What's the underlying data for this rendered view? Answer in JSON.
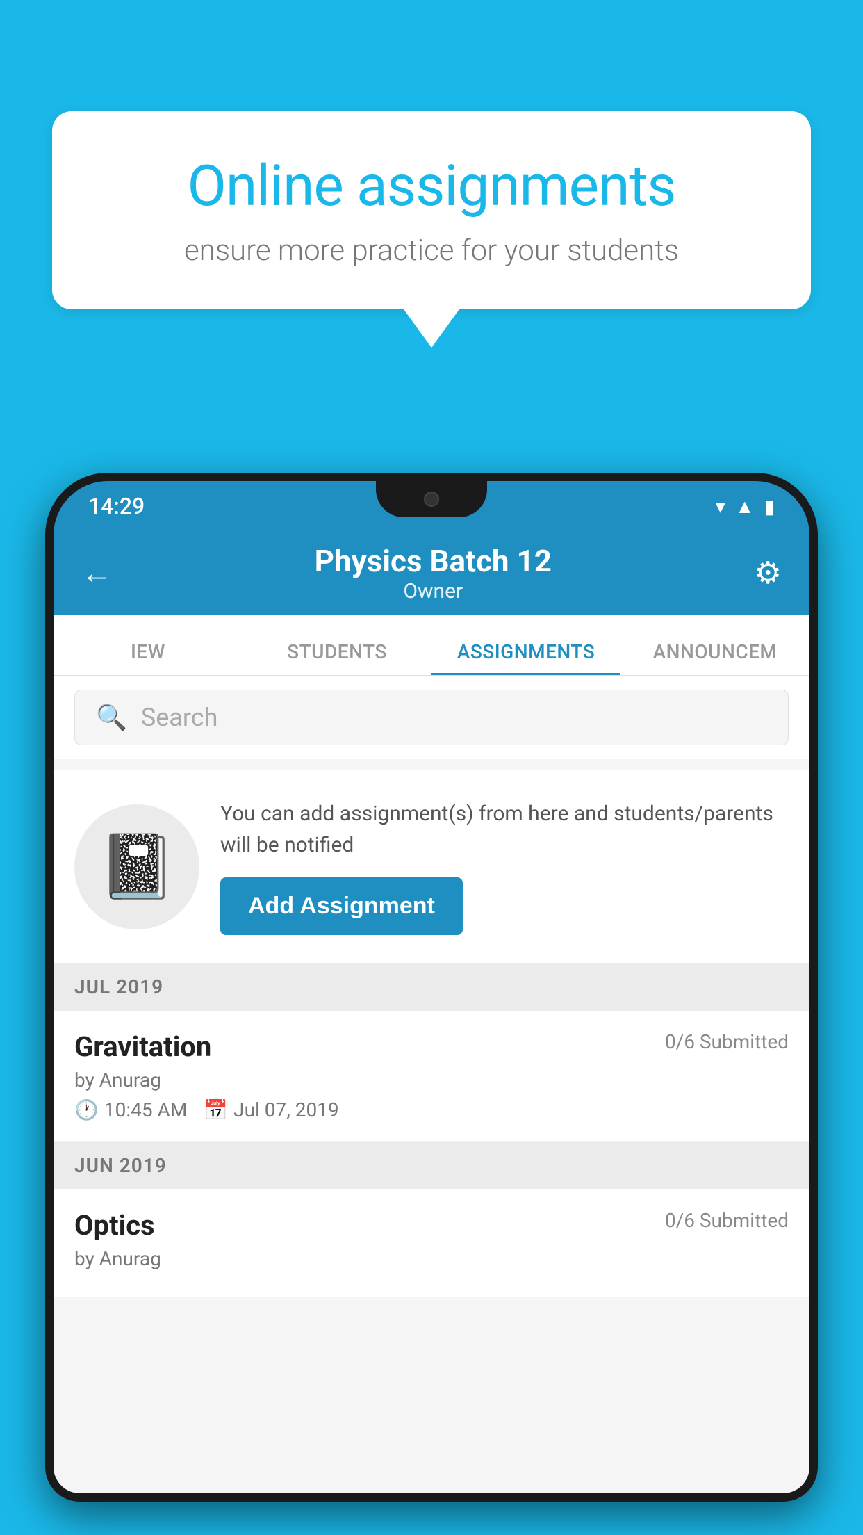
{
  "background_color": "#1ab8e8",
  "speech_bubble": {
    "title": "Online assignments",
    "subtitle": "ensure more practice for your students"
  },
  "app": {
    "status_bar": {
      "time": "14:29",
      "icons": [
        "wifi",
        "signal",
        "battery"
      ]
    },
    "header": {
      "title": "Physics Batch 12",
      "subtitle": "Owner",
      "back_label": "←",
      "gear_label": "⚙"
    },
    "tabs": [
      {
        "label": "IEW",
        "active": false
      },
      {
        "label": "STUDENTS",
        "active": false
      },
      {
        "label": "ASSIGNMENTS",
        "active": true
      },
      {
        "label": "ANNOUNCEM",
        "active": false
      }
    ],
    "search": {
      "placeholder": "Search"
    },
    "add_assignment_card": {
      "description": "You can add assignment(s) from here and students/parents will be notified",
      "button_label": "Add Assignment"
    },
    "sections": [
      {
        "header": "JUL 2019",
        "assignments": [
          {
            "name": "Gravitation",
            "submitted": "0/6 Submitted",
            "by": "by Anurag",
            "time": "10:45 AM",
            "date": "Jul 07, 2019"
          }
        ]
      },
      {
        "header": "JUN 2019",
        "assignments": [
          {
            "name": "Optics",
            "submitted": "0/6 Submitted",
            "by": "by Anurag",
            "time": "",
            "date": ""
          }
        ]
      }
    ]
  }
}
